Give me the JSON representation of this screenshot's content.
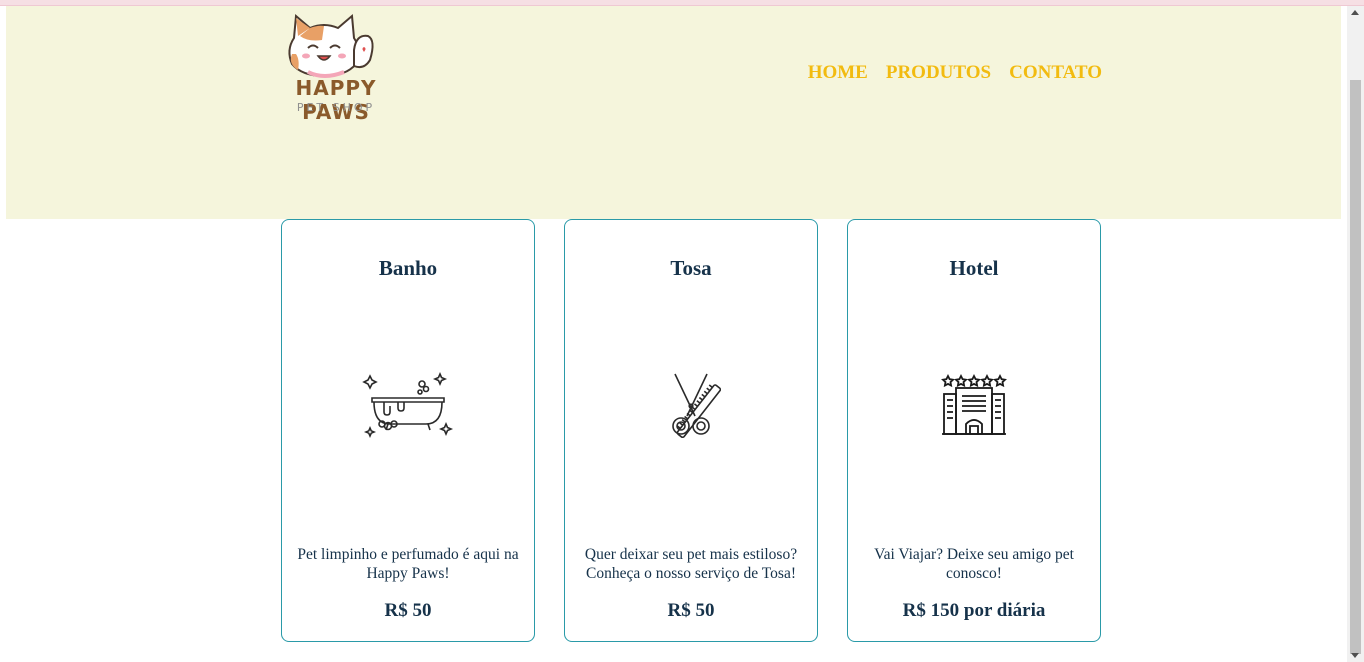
{
  "brand": {
    "title": "HAPPY PAWS",
    "subtitle": "PET SHOP",
    "logo_icon": "cat-waving-icon"
  },
  "nav": {
    "items": [
      {
        "label": "HOME"
      },
      {
        "label": "PRODUTOS"
      },
      {
        "label": "CONTATO"
      }
    ],
    "color": "#f2bb10"
  },
  "services": [
    {
      "title": "Banho",
      "icon": "bathtub-icon",
      "description": "Pet limpinho e perfumado é aqui na Happy Paws!",
      "price": "R$ 50"
    },
    {
      "title": "Tosa",
      "icon": "scissors-comb-icon",
      "description": "Quer deixar seu pet mais estiloso? Conheça o nosso serviço de Tosa!",
      "price": "R$ 50"
    },
    {
      "title": "Hotel",
      "icon": "hotel-icon",
      "description": "Vai Viajar? Deixe seu amigo pet conosco!",
      "price": "R$ 150 por diária"
    }
  ],
  "colors": {
    "header_bg": "#f5f5dc",
    "card_border": "#2a9aa8",
    "text": "#16324a"
  }
}
